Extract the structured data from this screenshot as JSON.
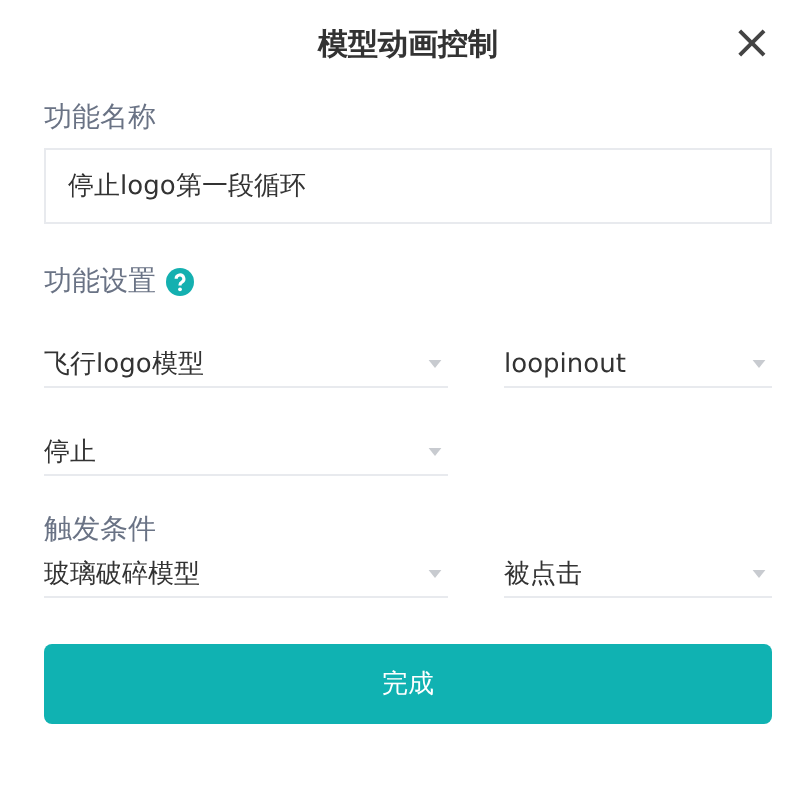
{
  "dialog": {
    "title": "模型动画控制",
    "close_icon": "×"
  },
  "name_field": {
    "label": "功能名称",
    "value": "停止logo第一段循环"
  },
  "settings": {
    "label": "功能设置",
    "rows": [
      {
        "selects": [
          {
            "value": "飞行logo模型"
          },
          {
            "value": "loopinout"
          }
        ]
      },
      {
        "selects": [
          {
            "value": "停止"
          }
        ]
      }
    ]
  },
  "trigger": {
    "label": "触发条件",
    "rows": [
      {
        "selects": [
          {
            "value": "玻璃破碎模型"
          },
          {
            "value": "被点击"
          }
        ]
      }
    ]
  },
  "buttons": [
    {
      "label": "完成",
      "kind": "primary"
    }
  ]
}
